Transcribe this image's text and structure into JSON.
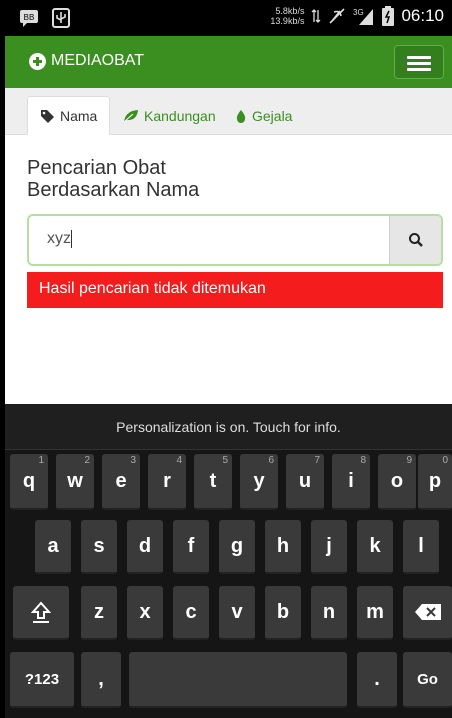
{
  "status_bar": {
    "speed_up": "5.8kb/s",
    "speed_down": "13.9kb/s",
    "network": "3G",
    "time": "06:10",
    "icons": [
      "bbm-icon",
      "usb-icon",
      "data-arrows-icon",
      "mute-icon",
      "signal-icon",
      "battery-icon"
    ]
  },
  "navbar": {
    "brand": "MEDIAOBAT",
    "brand_icon": "plus-circle-icon",
    "menu_icon": "hamburger-icon"
  },
  "tabs": [
    {
      "label": "Nama",
      "icon": "tag-icon"
    },
    {
      "label": "Kandungan",
      "icon": "leaf-icon"
    },
    {
      "label": "Gejala",
      "icon": "drop-icon"
    }
  ],
  "main": {
    "title_line1": "Pencarian Obat",
    "title_line2": "Berdasarkan Nama",
    "search_value": "xyz",
    "search_icon": "search-icon",
    "alert": "Hasil pencarian tidak ditemukan"
  },
  "keyboard": {
    "hint": "Personalization is on. Touch for info.",
    "row1": [
      "q",
      "w",
      "e",
      "r",
      "t",
      "y",
      "u",
      "i",
      "o",
      "p"
    ],
    "row1_nums": [
      "1",
      "2",
      "3",
      "4",
      "5",
      "6",
      "7",
      "8",
      "9",
      "0"
    ],
    "row2": [
      "a",
      "s",
      "d",
      "f",
      "g",
      "h",
      "j",
      "k",
      "l"
    ],
    "row3": [
      "z",
      "x",
      "c",
      "v",
      "b",
      "n",
      "m"
    ],
    "symbols": "?123",
    "comma": ",",
    "period": ".",
    "go": "Go"
  },
  "colors": {
    "navbar": "#3b8f21",
    "alert": "#f41c1c",
    "keyboard_bg": "#151515",
    "key": "#3a3a3a"
  }
}
